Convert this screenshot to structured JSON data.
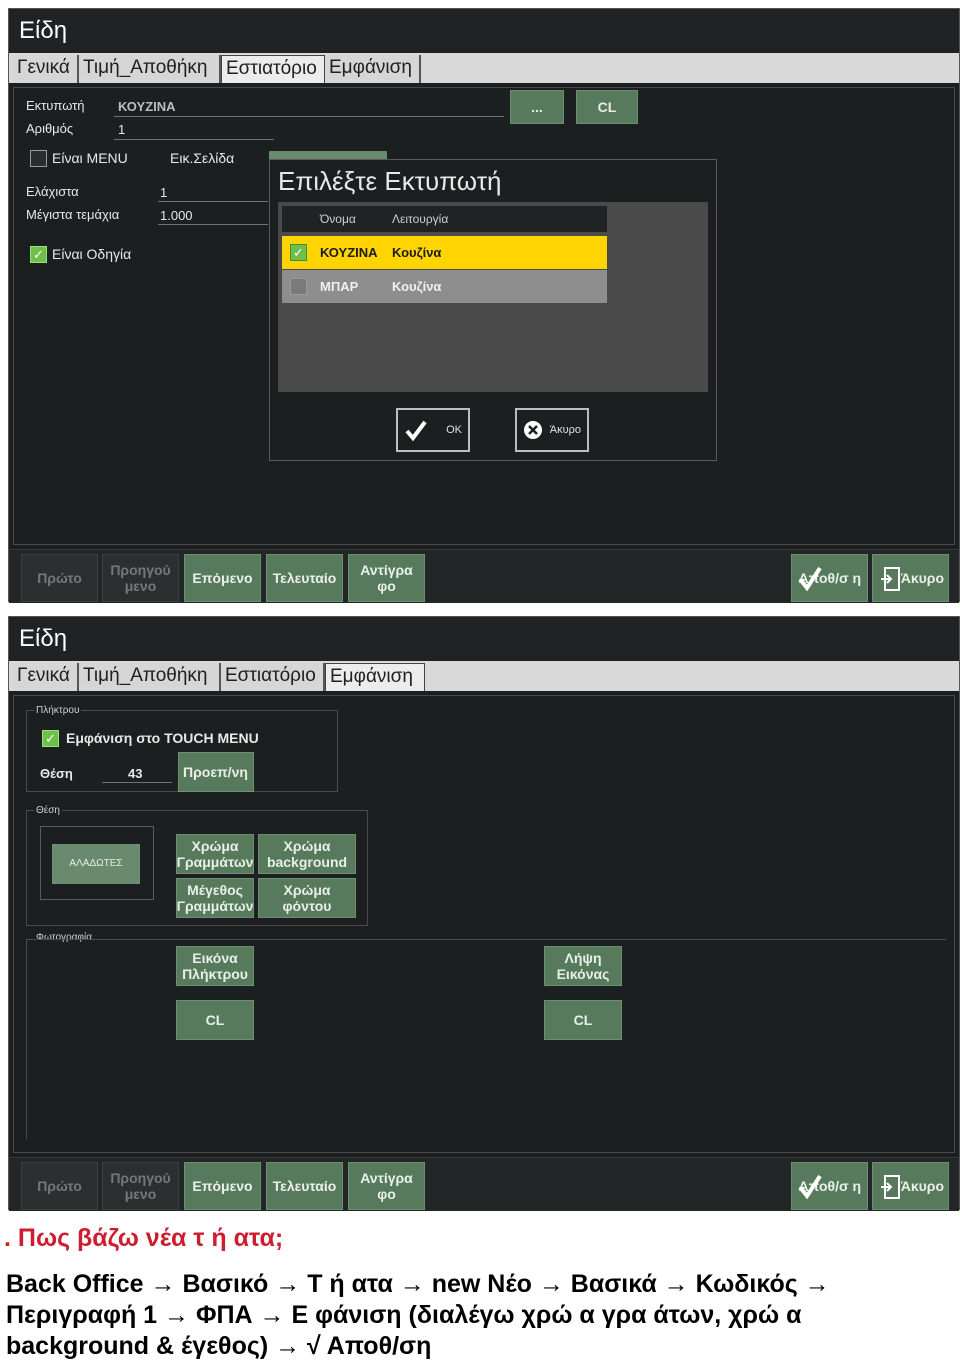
{
  "screen1": {
    "title": "Είδη",
    "tabs": [
      "Γενικά",
      "Τιμή_Αποθήκη",
      "Εστιατόριο",
      "Εμφάνιση"
    ],
    "printer_label": "Εκτυπωτή",
    "printer_value": "ΚΟΥΖΙΝΑ",
    "browse_button": "...",
    "cl_button": "CL",
    "number_label": "Αριθμός",
    "number_value": "1",
    "is_menu_label": "Είναι MENU",
    "pic_page_label": "Εικ.Σελίδα",
    "min_label": "Ελάχιστα",
    "min_value": "1",
    "max_label": "Μέγιστα τεμάχια",
    "max_value": "1.000",
    "is_guide_label": "Είναι Οδηγία",
    "dialog": {
      "title": "Επιλέξτε Εκτυπωτή",
      "col_name": "Όνομα",
      "col_function": "Λειτουργία",
      "rows": [
        {
          "name": "ΚΟΥΖΙΝΑ",
          "function": "Κουζίνα",
          "checked": true
        },
        {
          "name": "ΜΠΑΡ",
          "function": "Κουζίνα",
          "checked": false
        }
      ],
      "ok_label": "OK",
      "cancel_label": "Άκυρο"
    }
  },
  "screen2": {
    "title": "Είδη",
    "tabs": [
      "Γενικά",
      "Τιμή_Αποθήκη",
      "Εστιατόριο",
      "Εμφάνιση"
    ],
    "group_display": "Πλήκτρου",
    "show_touch_label": "Εμφάνιση στο TOUCH MENU",
    "position_label": "Θέση",
    "position_value": "43",
    "preview_button": "Προεπ/νη",
    "group_position": "Θέση",
    "sample_button": "ΑΛΑΔΩΤΕΣ",
    "text_color_button": "Χρώμα Γραμμάτων",
    "bg_color_button": "Χρώμα background",
    "text_size_button": "Μέγεθος Γραμμάτων",
    "font_color_button": "Χρώμα φόντου",
    "group_photo": "Φωτογραφία",
    "key_image_button": "Εικόνα Πλήκτρου",
    "get_image_button": "Λήψη Εικόνας",
    "cl_left": "CL",
    "cl_right": "CL"
  },
  "bottom_buttons": {
    "first": "Πρώτο",
    "previous": "Προηγού μενο",
    "next": "Επόμενο",
    "last": "Τελευταίο",
    "copy": "Αντίγρα φο",
    "save": "Αποθ/σ η",
    "cancel": "Άκυρο"
  },
  "caption": ". Πως βάζω νέα τ  ή  ατα;",
  "instructions": [
    " Back Office → Βασικό → Τ  ή  ατα → new Νέο → Βασικά → Κωδικός →",
    "Περιγραφή 1 → ΦΠΑ → Ε  φάνιση (διαλέγω χρώ  α γρα     άτων, χρώ  α",
    "background &   έγεθος) → √ Αποθ/ση"
  ],
  "colors": {
    "window_bg": "#1c1f1f",
    "button_green": "#577a5c",
    "selected_row": "#ffd400",
    "caption_red": "#cc1e2e"
  }
}
